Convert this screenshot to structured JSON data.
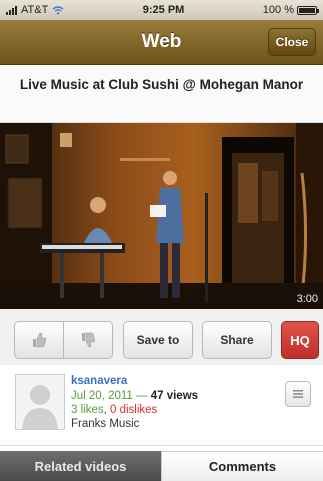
{
  "status_bar": {
    "carrier": "AT&T",
    "time": "9:25 PM",
    "battery_text": "100 %",
    "battery_level": 1.0,
    "wifi_icon": "wifi-icon"
  },
  "nav": {
    "title": "Web",
    "close_label": "Close"
  },
  "video": {
    "title": "Live Music at Club Sushi @ Mohegan Manor",
    "duration": "3:00"
  },
  "actions": {
    "like_icon": "thumbs-up-icon",
    "dislike_icon": "thumbs-down-icon",
    "save_label": "Save to",
    "share_label": "Share",
    "hq_label": "HQ"
  },
  "info": {
    "uploader": "ksanavera",
    "date": "Jul 20, 2011 —",
    "views": "47 views",
    "likes": "3 likes",
    "dislikes": "0 dislikes",
    "category": "Franks Music"
  },
  "tabs": {
    "related": "Related videos",
    "comments": "Comments"
  },
  "colors": {
    "nav_gold": "#8a6d2c",
    "hq_red": "#d0312d",
    "link_blue": "#3a6ec4",
    "like_green": "#5a9b3a"
  }
}
